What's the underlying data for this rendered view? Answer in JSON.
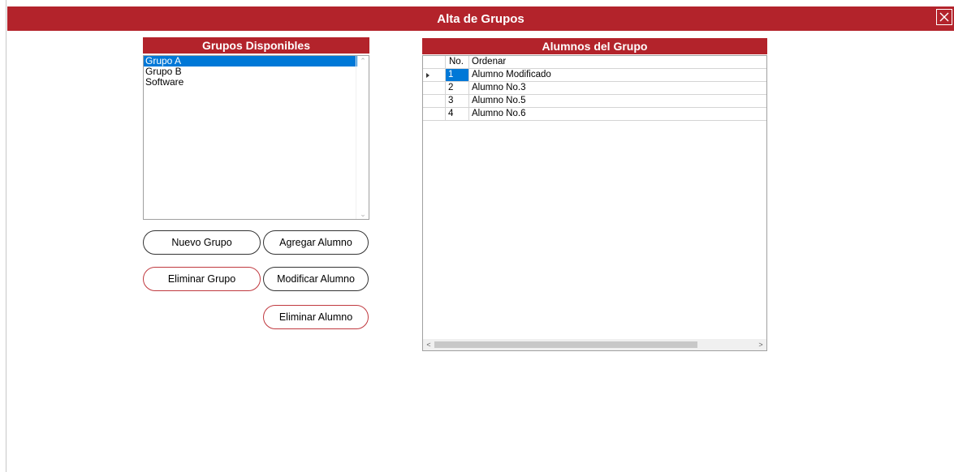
{
  "window": {
    "title": "Alta de Grupos",
    "close_icon": "close-icon"
  },
  "groups_panel": {
    "header": "Grupos Disponibles",
    "items": [
      {
        "label": "Grupo A",
        "selected": true
      },
      {
        "label": "Grupo B",
        "selected": false
      },
      {
        "label": "Software",
        "selected": false
      }
    ]
  },
  "buttons": {
    "new_group": "Nuevo Grupo",
    "add_student": "Agregar Alumno",
    "delete_group": "Eliminar Grupo",
    "modify_student": "Modificar Alumno",
    "delete_student": "Eliminar Alumno"
  },
  "students_panel": {
    "header": "Alumnos del Grupo",
    "columns": [
      "No.",
      "Ordenar"
    ],
    "rows": [
      {
        "no": "1",
        "name": "Alumno Modificado",
        "current": true
      },
      {
        "no": "2",
        "name": "Alumno No.3",
        "current": false
      },
      {
        "no": "3",
        "name": "Alumno No.5",
        "current": false
      },
      {
        "no": "4",
        "name": "Alumno No.6",
        "current": false
      }
    ]
  },
  "colors": {
    "accent": "#b3232b",
    "selection": "#0078d7",
    "danger_border": "#c0393f"
  }
}
